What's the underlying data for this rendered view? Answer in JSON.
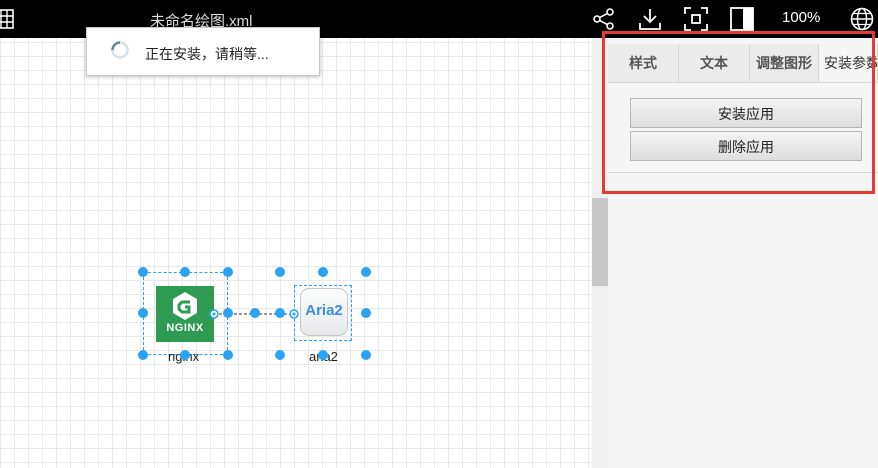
{
  "header": {
    "title": "未命名绘图.xml",
    "zoom": "100%",
    "icons": [
      "grid-icon",
      "share-icon",
      "download-icon",
      "fullscreen-icon",
      "format-panel-icon",
      "globe-icon"
    ]
  },
  "toast": {
    "message": "正在安装，请稍等..."
  },
  "panel": {
    "tabs": [
      {
        "label": "样式",
        "active": false
      },
      {
        "label": "文本",
        "active": false
      },
      {
        "label": "调整图形",
        "active": false
      },
      {
        "label": "安装参数",
        "active": true
      }
    ],
    "buttons": {
      "install": "安装应用",
      "delete": "删除应用"
    },
    "highlight_color": "#e53935"
  },
  "diagram": {
    "nodes": [
      {
        "id": "nginx",
        "label": "nginx",
        "logo_text": "NGINX",
        "color": "#2e9a52"
      },
      {
        "id": "aria2",
        "label": "aria2",
        "logo_text": "Aria2",
        "color": "#3a8fe0"
      }
    ],
    "selection_color": "#29a3f5"
  }
}
